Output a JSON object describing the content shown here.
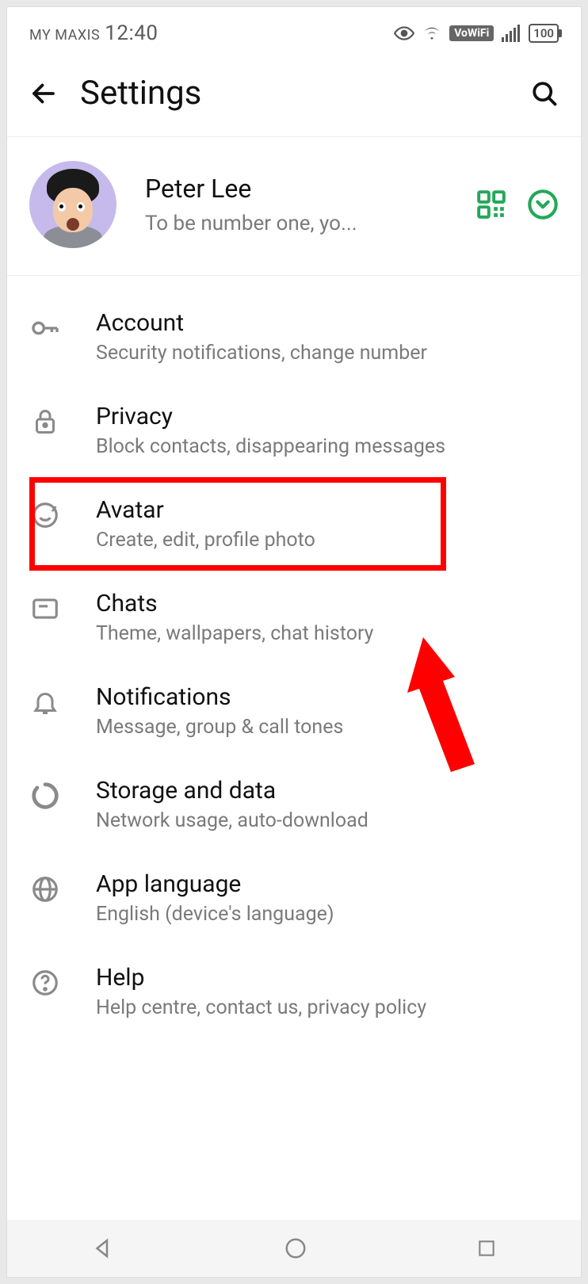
{
  "status_bar": {
    "carrier": "MY MAXIS",
    "time": "12:40",
    "battery": "100"
  },
  "header": {
    "title": "Settings"
  },
  "profile": {
    "name": "Peter Lee",
    "status": "To be number one, yo..."
  },
  "settings": [
    {
      "title": "Account",
      "subtitle": "Security notifications, change number"
    },
    {
      "title": "Privacy",
      "subtitle": "Block contacts, disappearing messages"
    },
    {
      "title": "Avatar",
      "subtitle": "Create, edit, profile photo"
    },
    {
      "title": "Chats",
      "subtitle": "Theme, wallpapers, chat history"
    },
    {
      "title": "Notifications",
      "subtitle": "Message, group & call tones"
    },
    {
      "title": "Storage and data",
      "subtitle": "Network usage, auto-download"
    },
    {
      "title": "App language",
      "subtitle": "English (device's language)"
    },
    {
      "title": "Help",
      "subtitle": "Help centre, contact us, privacy policy"
    }
  ]
}
